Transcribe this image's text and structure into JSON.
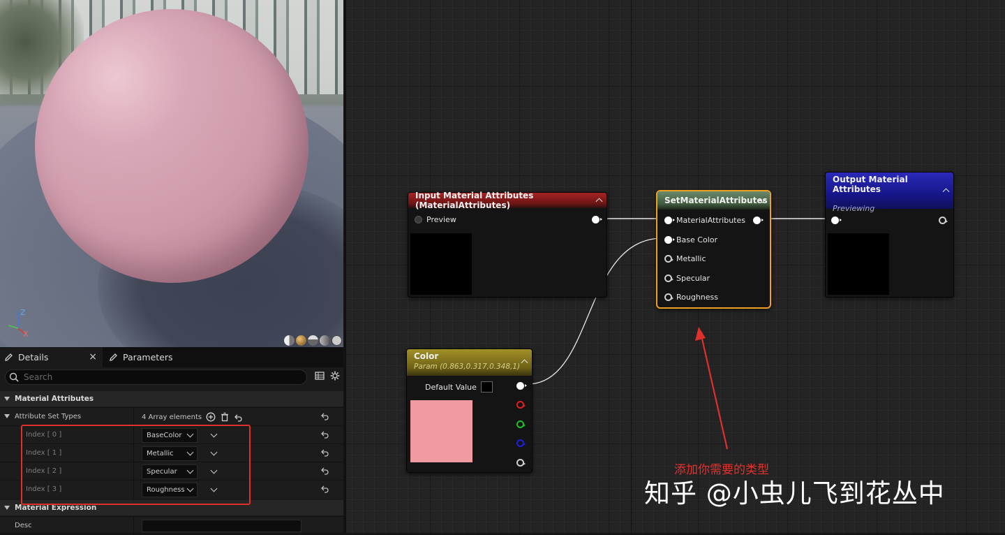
{
  "viewport": {
    "axis_z": "Z",
    "axis_x": "X",
    "colors": {
      "sphere": "#d9a7b7"
    }
  },
  "details": {
    "tabs": [
      {
        "label": "Details"
      },
      {
        "label": "Parameters"
      }
    ],
    "search_placeholder": "Search",
    "sections": {
      "material_attributes": "Material Attributes",
      "material_expression": "Material Expression"
    },
    "attribute_set_types": {
      "label": "Attribute Set Types",
      "count_text": "4 Array elements"
    },
    "indices": [
      {
        "label": "Index [ 0 ]",
        "value": "BaseColor"
      },
      {
        "label": "Index [ 1 ]",
        "value": "Metallic"
      },
      {
        "label": "Index [ 2 ]",
        "value": "Specular"
      },
      {
        "label": "Index [ 3 ]",
        "value": "Roughness"
      }
    ],
    "desc_label": "Desc"
  },
  "graph": {
    "input_node": {
      "title": "Input Material Attributes (MaterialAttributes)",
      "pin": "Preview",
      "header_color": "#8a1a1a"
    },
    "set_node": {
      "title": "SetMaterialAttributes",
      "pins": [
        "MaterialAttributes",
        "Base Color",
        "Metallic",
        "Specular",
        "Roughness"
      ],
      "header_color": "#4f6b4f",
      "highlight": "#f0a020"
    },
    "output_node": {
      "title": "Output Material Attributes",
      "subtitle": "Previewing",
      "header_color": "#1e1e9a"
    },
    "color_node": {
      "title": "Color",
      "subtitle": "Param (0.863,0.317,0.348,1)",
      "default_label": "Default Value",
      "swatch": "#ee9aa0",
      "header_color": "#8a7a1a"
    },
    "annotation": "添加你需要的类型",
    "watermark": "知乎 @小虫儿飞到花丛中"
  }
}
